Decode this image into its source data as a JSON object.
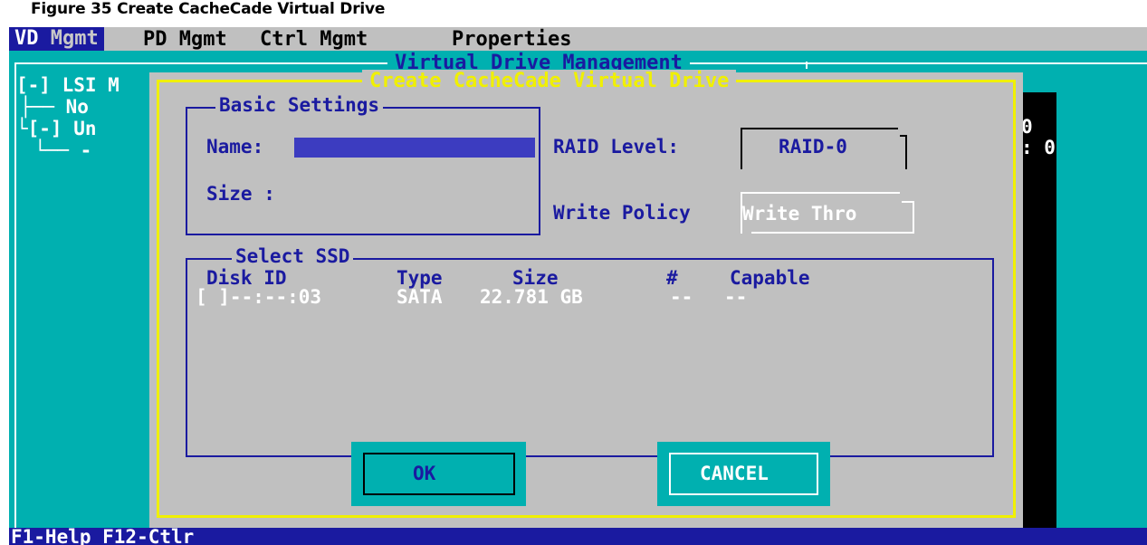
{
  "caption": "Figure 35  Create CacheCade Virtual Drive",
  "menubar": {
    "vd_hot": "VD",
    "vd_rest": " Mgmt",
    "pd": "PD Mgmt",
    "ctrl": "Ctrl Mgmt",
    "properties": "Properties"
  },
  "panel": {
    "title": "Virtual Drive Management"
  },
  "tree": {
    "lsi": "[-] LSI M",
    "no": "├── No",
    "un": "└[-] Un",
    "dash": "└── -"
  },
  "right_column": {
    "line1": "0",
    "line2": ": 0"
  },
  "dialog": {
    "title": "Create CacheCade Virtual Drive",
    "basic_settings": {
      "title": "Basic Settings",
      "name_label": "Name:",
      "name_value": "",
      "size_label": "Size :"
    },
    "raid_level": {
      "label": "RAID Level:",
      "value": "RAID-0"
    },
    "write_policy": {
      "label": "Write Policy",
      "value": "Write Thro"
    },
    "select_ssd": {
      "title": "Select SSD",
      "columns": [
        "Disk ID",
        "Type",
        "Size",
        "#",
        "Capable"
      ],
      "rows": [
        {
          "disk_id": "[ ]--:--:03",
          "type": "SATA",
          "size": "22.781 GB",
          "num": "--",
          "capable": "--"
        }
      ]
    },
    "buttons": {
      "ok": "OK",
      "cancel": "CANCEL"
    }
  },
  "statusbar": {
    "text": "F1-Help F12-Ctlr"
  },
  "colors": {
    "screen_bg": "#00b0b0",
    "dialog_bg": "#c0c0c0",
    "accent_blue": "#1a1aa0",
    "frame_yellow": "#f0f000"
  }
}
